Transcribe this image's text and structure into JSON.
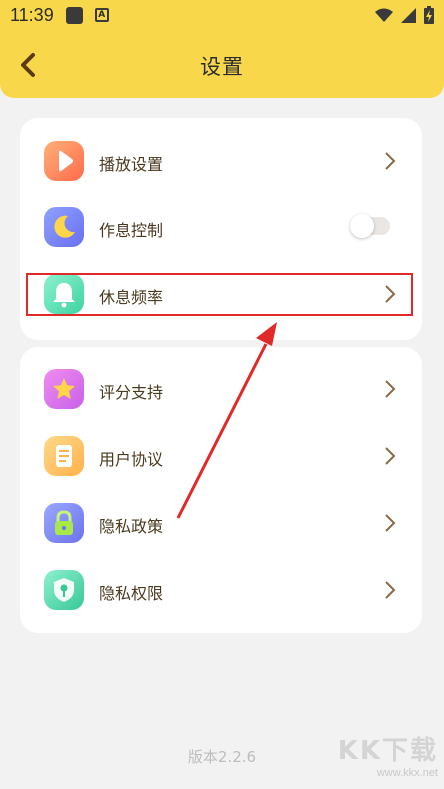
{
  "status_bar": {
    "time": "11:39",
    "icons": [
      "notification-square-icon",
      "a-badge-icon",
      "wifi-icon",
      "signal-icon",
      "battery-charging-icon"
    ]
  },
  "header": {
    "title": "设置",
    "back_icon": "chevron-left-icon",
    "background": "#f8d84a"
  },
  "settings_group_1": {
    "items": [
      {
        "label": "播放设置",
        "icon": "play-icon",
        "control": "chevron-right-icon"
      },
      {
        "label": "作息控制",
        "icon": "moon-icon",
        "control": "toggle",
        "toggle_on": false
      },
      {
        "label": "休息频率",
        "icon": "bell-icon",
        "control": "chevron-right-icon",
        "highlighted": true
      }
    ]
  },
  "settings_group_2": {
    "items": [
      {
        "label": "评分支持",
        "icon": "star-icon",
        "control": "chevron-right-icon"
      },
      {
        "label": "用户协议",
        "icon": "document-icon",
        "control": "chevron-right-icon"
      },
      {
        "label": "隐私政策",
        "icon": "lock-icon",
        "control": "chevron-right-icon"
      },
      {
        "label": "隐私权限",
        "icon": "shield-key-icon",
        "control": "chevron-right-icon"
      }
    ]
  },
  "footer": {
    "version": "版本2.2.6"
  },
  "watermark": {
    "brand": "KK下载",
    "url": "www.kkx.net"
  },
  "annotation": {
    "highlight_color": "#e02a2a"
  }
}
